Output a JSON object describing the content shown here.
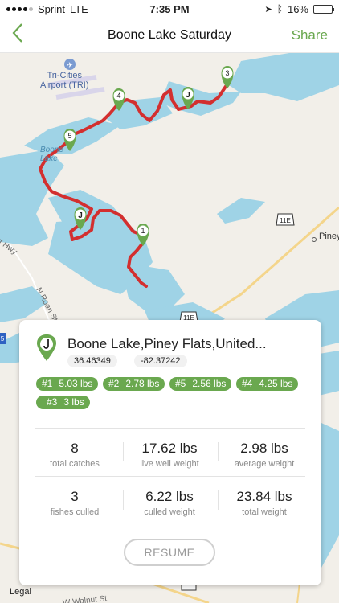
{
  "status": {
    "carrier": "Sprint",
    "network": "LTE",
    "time": "7:35 PM",
    "battery": "16%",
    "battery_level": 0.16
  },
  "nav": {
    "back_icon": "chevron-left-icon",
    "title": "Boone Lake Saturday",
    "share_label": "Share"
  },
  "map": {
    "labels": {
      "airport": "Tri-Cities\nAirport (TRI)",
      "lake": "Boone\nLake",
      "town": "Piney",
      "road_left": "rt Hwy",
      "road_roan": "N Roan St",
      "road_walnut": "W Walnut St"
    },
    "shields": {
      "us_11e_upper": "11E",
      "us_11e_lower": "11E",
      "interstate": "5",
      "lower_road": ""
    },
    "markers": [
      "4",
      "J",
      "3",
      "5",
      "J",
      "1"
    ],
    "legal": "Legal"
  },
  "card": {
    "location_name": "Boone Lake,Piney Flats,United...",
    "latitude": "36.46349",
    "longitude": "-82.37242",
    "catches": [
      {
        "rank": "#1",
        "weight": "5.03 lbs"
      },
      {
        "rank": "#2",
        "weight": "2.78 lbs"
      },
      {
        "rank": "#5",
        "weight": "2.56 lbs"
      },
      {
        "rank": "#4",
        "weight": "4.25 lbs"
      },
      {
        "rank": "#3",
        "weight": "3 lbs"
      }
    ],
    "stats": [
      {
        "value": "8",
        "label": "total catches"
      },
      {
        "value": "17.62 lbs",
        "label": "live well weight"
      },
      {
        "value": "2.98 lbs",
        "label": "average weight"
      },
      {
        "value": "3",
        "label": "fishes culled"
      },
      {
        "value": "6.22 lbs",
        "label": "culled weight"
      },
      {
        "value": "23.84 lbs",
        "label": "total weight"
      }
    ],
    "resume_label": "RESUME"
  },
  "colors": {
    "accent": "#6aa84f",
    "route": "#d32f2f",
    "water": "#9fd3e6",
    "land": "#f2efe9"
  }
}
